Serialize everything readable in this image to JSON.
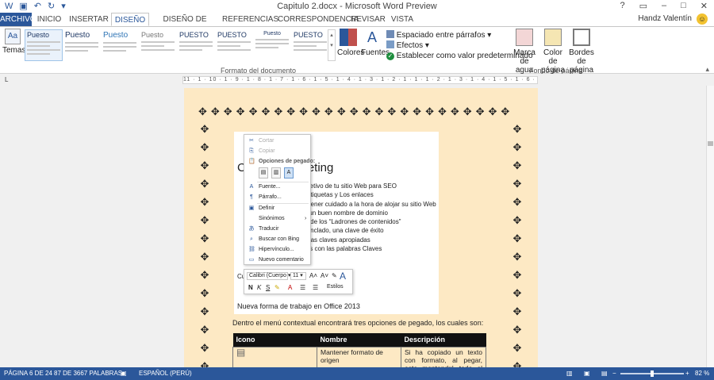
{
  "window": {
    "title": "Capitulo 2.docx - Microsoft Word Preview",
    "user": "Handz Valentín",
    "controls": [
      "?",
      "▭",
      "–",
      "□",
      "✕"
    ]
  },
  "tabs": [
    "ARCHIVO",
    "INICIO",
    "INSERTAR",
    "DISEÑO",
    "DISEÑO DE PÁGINA",
    "REFERENCIAS",
    "CORRESPONDENCIA",
    "REVISAR",
    "VISTA"
  ],
  "ribbon": {
    "temas": "Temas",
    "styles": [
      "Puesto",
      "Puesto",
      "Puesto",
      "Puesto",
      "PUESTO",
      "PUESTO",
      "Puesto",
      "PUESTO"
    ],
    "formato_label": "Formato del documento",
    "colores": "Colores",
    "fuentes": "Fuentes",
    "espaciado": "Espaciado entre párrafos",
    "efectos": "Efectos",
    "predeterminado": "Establecer como valor predeterminado",
    "marca_agua": "Marca de agua",
    "color_pagina": "Color de página",
    "bordes_pagina": "Bordes de página",
    "fondo_label": "Fondo de página"
  },
  "ruler": "11 · 1 · 10 · 1 · 9 · 1 · 8 · 1 · 7 · 1 · 6 · 1 · 5 · 1 · 4 · 1 · 3 · 1 · 2 · 1 · 1 · 1 · 2 · 1 · 3 · 1 · 4 · 1 · 5 · 1 · 6 · 1 · 7 · 1",
  "document": {
    "heading_start": "C",
    "heading_end": "eting",
    "lines": [
      "objetivo de tu sitio Web para SEO",
      "s Etiquetas y Los enlaces",
      "ra tener cuidado a la hora de alojar su sitio Web",
      "ra un buen nombre de dominio",
      "do de los “Ladrones de contenidos”",
      "o anclado, una clave de éxito",
      "abras claves apropiadas",
      "icas con las palabras Claves"
    ],
    "cut_text": "Cu",
    "caption": "Nueva forma de trabajo en Office 2013",
    "body": "Dentro el menú contextual encontrará tres opciones de pegado, los cuales son:",
    "table": {
      "headers": [
        "Icono",
        "Nombre",
        "Descripción"
      ],
      "row_name": "Mantener formato de origen",
      "row_desc": "Si ha copiado un texto con formato, al pegar, este mantendrá todo el formato"
    }
  },
  "context_menu": {
    "cortar": "Cortar",
    "copiar": "Copiar",
    "opciones": "Opciones de pegado:",
    "fuente": "Fuente...",
    "parrafo": "Párrafo...",
    "definir": "Definir",
    "sinonimos": "Sinónimos",
    "traducir": "Traducir",
    "buscar": "Buscar con Bing",
    "hipervinculo": "Hipervínculo...",
    "comentario": "Nuevo comentario"
  },
  "mini_toolbar": {
    "font": "Calibri (Cuerpo",
    "size": "11",
    "estilos": "Estilos"
  },
  "status": {
    "pagina": "PÁGINA 6 DE 24",
    "palabras": "87 DE 3667 PALABRAS",
    "idioma": "ESPAÑOL (PERÚ)",
    "zoom": "82 %"
  }
}
